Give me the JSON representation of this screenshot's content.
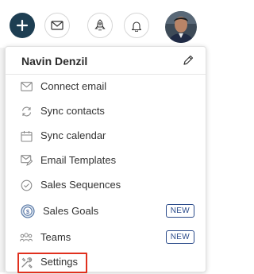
{
  "user": {
    "name": "Navin Denzil"
  },
  "menu": {
    "items": [
      {
        "label": "Connect email",
        "icon": "mail-icon"
      },
      {
        "label": "Sync contacts",
        "icon": "sync-icon"
      },
      {
        "label": "Sync calendar",
        "icon": "calendar-icon"
      },
      {
        "label": "Email Templates",
        "icon": "email-template-icon"
      },
      {
        "label": "Sales Sequences",
        "icon": "sequence-icon"
      },
      {
        "label": "Sales Goals",
        "icon": "goal-icon",
        "badge": "NEW"
      },
      {
        "label": "Teams",
        "icon": "teams-icon",
        "badge": "NEW"
      },
      {
        "label": "Settings",
        "icon": "settings-icon",
        "highlighted": true
      }
    ]
  },
  "colors": {
    "add_button": "#1d3e52",
    "badge": "#2a4a8a",
    "highlight": "#e0301e"
  }
}
